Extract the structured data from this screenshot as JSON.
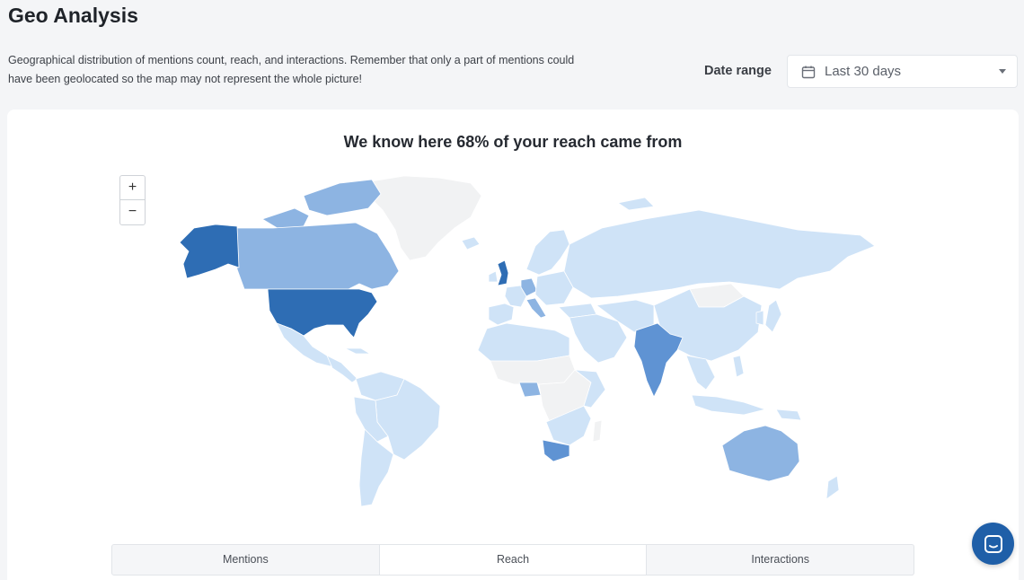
{
  "page": {
    "title": "Geo Analysis",
    "description": "Geographical distribution of mentions count, reach, and interactions. Remember that only a part of mentions could have been geolocated so the map may not represent the whole picture!"
  },
  "filters": {
    "date_range_label": "Date range",
    "date_range_value": "Last 30 days",
    "date_icon": "calendar-icon"
  },
  "map": {
    "title": "We know here 68% of your reach came from",
    "zoom_in": "+",
    "zoom_out": "−",
    "colors": {
      "none": "#f1f2f3",
      "low": "#cfe3f7",
      "medium": "#8db4e2",
      "high": "#5f93d3",
      "top": "#2e6db4"
    }
  },
  "tabs": [
    {
      "label": "Mentions",
      "active": false
    },
    {
      "label": "Reach",
      "active": true
    },
    {
      "label": "Interactions",
      "active": false
    }
  ],
  "chat": {
    "icon": "chat-icon"
  }
}
